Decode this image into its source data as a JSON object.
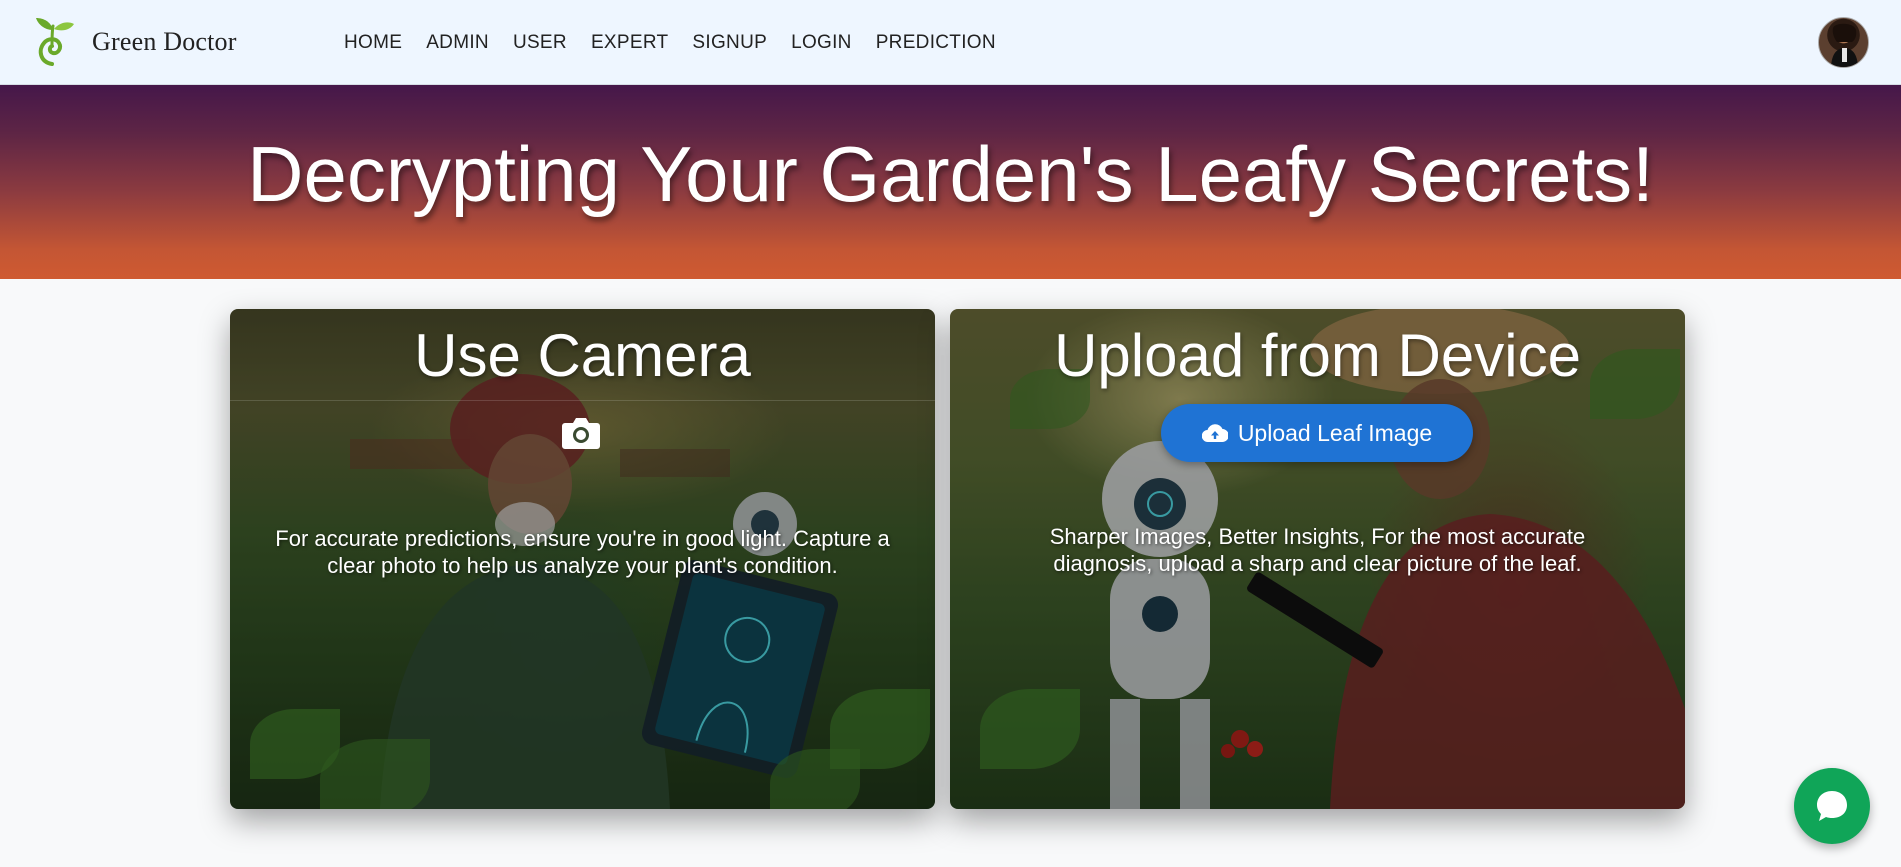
{
  "brand": {
    "name": "Green Doctor",
    "logo_icon": "sprout-logo-icon"
  },
  "nav": {
    "items": [
      {
        "label": "HOME"
      },
      {
        "label": "ADMIN"
      },
      {
        "label": "USER"
      },
      {
        "label": "EXPERT"
      },
      {
        "label": "SIGNUP"
      },
      {
        "label": "LOGIN"
      },
      {
        "label": "PREDICTION"
      }
    ]
  },
  "user": {
    "avatar_icon": "user-avatar"
  },
  "hero": {
    "title": "Decrypting Your Garden's Leafy Secrets!"
  },
  "camera_card": {
    "title": "Use Camera",
    "icon": "camera-icon",
    "text": "For accurate predictions, ensure you're in good light. Capture a clear photo to help us analyze your plant's condition."
  },
  "upload_card": {
    "title": "Upload from Device",
    "button_label": "Upload Leaf Image",
    "button_icon": "cloud-upload-icon",
    "text": "Sharper Images, Better Insights, For the most accurate diagnosis, upload a sharp and clear picture of the leaf."
  },
  "chat": {
    "icon": "chat-bubble-icon"
  },
  "colors": {
    "navbar_bg": "#eef6ff",
    "hero_top": "#45174a",
    "hero_bottom": "#cf5a31",
    "upload_button": "#1f73d4",
    "chat_button": "#10a558"
  }
}
